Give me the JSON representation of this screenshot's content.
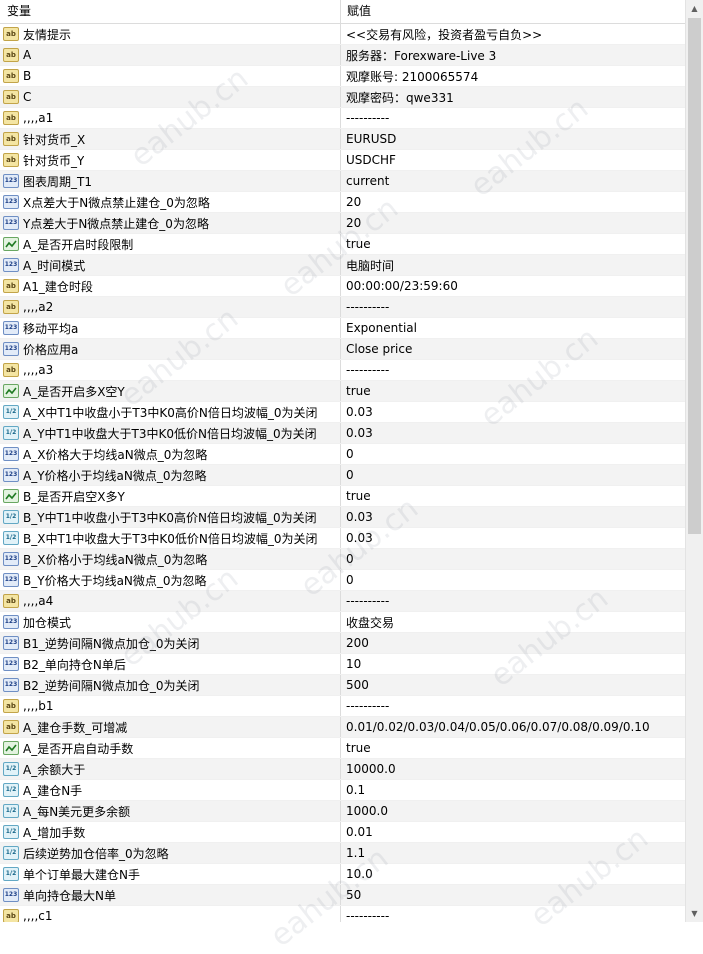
{
  "header": {
    "col_variable": "变量",
    "col_value": "赋值"
  },
  "watermark": "eahub.cn",
  "rows": [
    {
      "icon": "ab",
      "name": "友情提示",
      "value": "<<交易有风险，投资者盈亏自负>>"
    },
    {
      "icon": "ab",
      "name": "A",
      "value": "服务器：Forexware-Live 3"
    },
    {
      "icon": "ab",
      "name": "B",
      "value": "观摩账号: 2100065574"
    },
    {
      "icon": "ab",
      "name": "C",
      "value": "观摩密码：qwe331"
    },
    {
      "icon": "ab",
      "name": ",,,,a1",
      "value": "----------"
    },
    {
      "icon": "ab",
      "name": "针对货币_X",
      "value": "EURUSD"
    },
    {
      "icon": "ab",
      "name": "针对货币_Y",
      "value": "USDCHF"
    },
    {
      "icon": "i123",
      "name": "图表周期_T1",
      "value": "current"
    },
    {
      "icon": "i123",
      "name": "X点差大于N微点禁止建仓_0为忽略",
      "value": "20"
    },
    {
      "icon": "i123",
      "name": "Y点差大于N微点禁止建仓_0为忽略",
      "value": "20"
    },
    {
      "icon": "bool",
      "name": "A_是否开启时段限制",
      "value": "true"
    },
    {
      "icon": "i123",
      "name": "A_时间模式",
      "value": "电脑时间"
    },
    {
      "icon": "ab",
      "name": "A1_建仓时段",
      "value": "00:00:00/23:59:60"
    },
    {
      "icon": "ab",
      "name": ",,,,a2",
      "value": "----------"
    },
    {
      "icon": "i123",
      "name": "移动平均a",
      "value": "Exponential"
    },
    {
      "icon": "i123",
      "name": "价格应用a",
      "value": "Close price"
    },
    {
      "icon": "ab",
      "name": ",,,,a3",
      "value": "----------"
    },
    {
      "icon": "bool",
      "name": "A_是否开启多X空Y",
      "value": "true"
    },
    {
      "icon": "d12",
      "name": "A_X中T1中收盘小于T3中K0高价N倍日均波幅_0为关闭",
      "value": "0.03"
    },
    {
      "icon": "d12",
      "name": "A_Y中T1中收盘大于T3中K0低价N倍日均波幅_0为关闭",
      "value": "0.03"
    },
    {
      "icon": "i123",
      "name": "A_X价格大于均线aN微点_0为忽略",
      "value": "0"
    },
    {
      "icon": "i123",
      "name": "A_Y价格小于均线aN微点_0为忽略",
      "value": "0"
    },
    {
      "icon": "bool",
      "name": "B_是否开启空X多Y",
      "value": "true"
    },
    {
      "icon": "d12",
      "name": "B_Y中T1中收盘小于T3中K0高价N倍日均波幅_0为关闭",
      "value": "0.03"
    },
    {
      "icon": "d12",
      "name": "B_X中T1中收盘大于T3中K0低价N倍日均波幅_0为关闭",
      "value": "0.03"
    },
    {
      "icon": "i123",
      "name": "B_X价格小于均线aN微点_0为忽略",
      "value": "0"
    },
    {
      "icon": "i123",
      "name": "B_Y价格大于均线aN微点_0为忽略",
      "value": "0"
    },
    {
      "icon": "ab",
      "name": ",,,,a4",
      "value": "----------"
    },
    {
      "icon": "i123",
      "name": "加仓模式",
      "value": "收盘交易"
    },
    {
      "icon": "i123",
      "name": "B1_逆势间隔N微点加仓_0为关闭",
      "value": "200"
    },
    {
      "icon": "i123",
      "name": "B2_单向持仓N单后",
      "value": "10"
    },
    {
      "icon": "i123",
      "name": "B2_逆势间隔N微点加仓_0为关闭",
      "value": "500"
    },
    {
      "icon": "ab",
      "name": ",,,,b1",
      "value": "----------"
    },
    {
      "icon": "ab",
      "name": "A_建仓手数_可增减",
      "value": "0.01/0.02/0.03/0.04/0.05/0.06/0.07/0.08/0.09/0.10"
    },
    {
      "icon": "bool",
      "name": "A_是否开启自动手数",
      "value": "true"
    },
    {
      "icon": "d12",
      "name": "A_余额大于",
      "value": "10000.0"
    },
    {
      "icon": "d12",
      "name": "A_建仓N手",
      "value": "0.1"
    },
    {
      "icon": "d12",
      "name": "A_每N美元更多余额",
      "value": "1000.0"
    },
    {
      "icon": "d12",
      "name": "A_增加手数",
      "value": "0.01"
    },
    {
      "icon": "d12",
      "name": "后续逆势加仓倍率_0为忽略",
      "value": "1.1"
    },
    {
      "icon": "d12",
      "name": "单个订单最大建仓N手",
      "value": "10.0"
    },
    {
      "icon": "i123",
      "name": "单向持仓最大N单",
      "value": "50"
    },
    {
      "icon": "ab",
      "name": ",,,,c1",
      "value": "----------"
    }
  ]
}
